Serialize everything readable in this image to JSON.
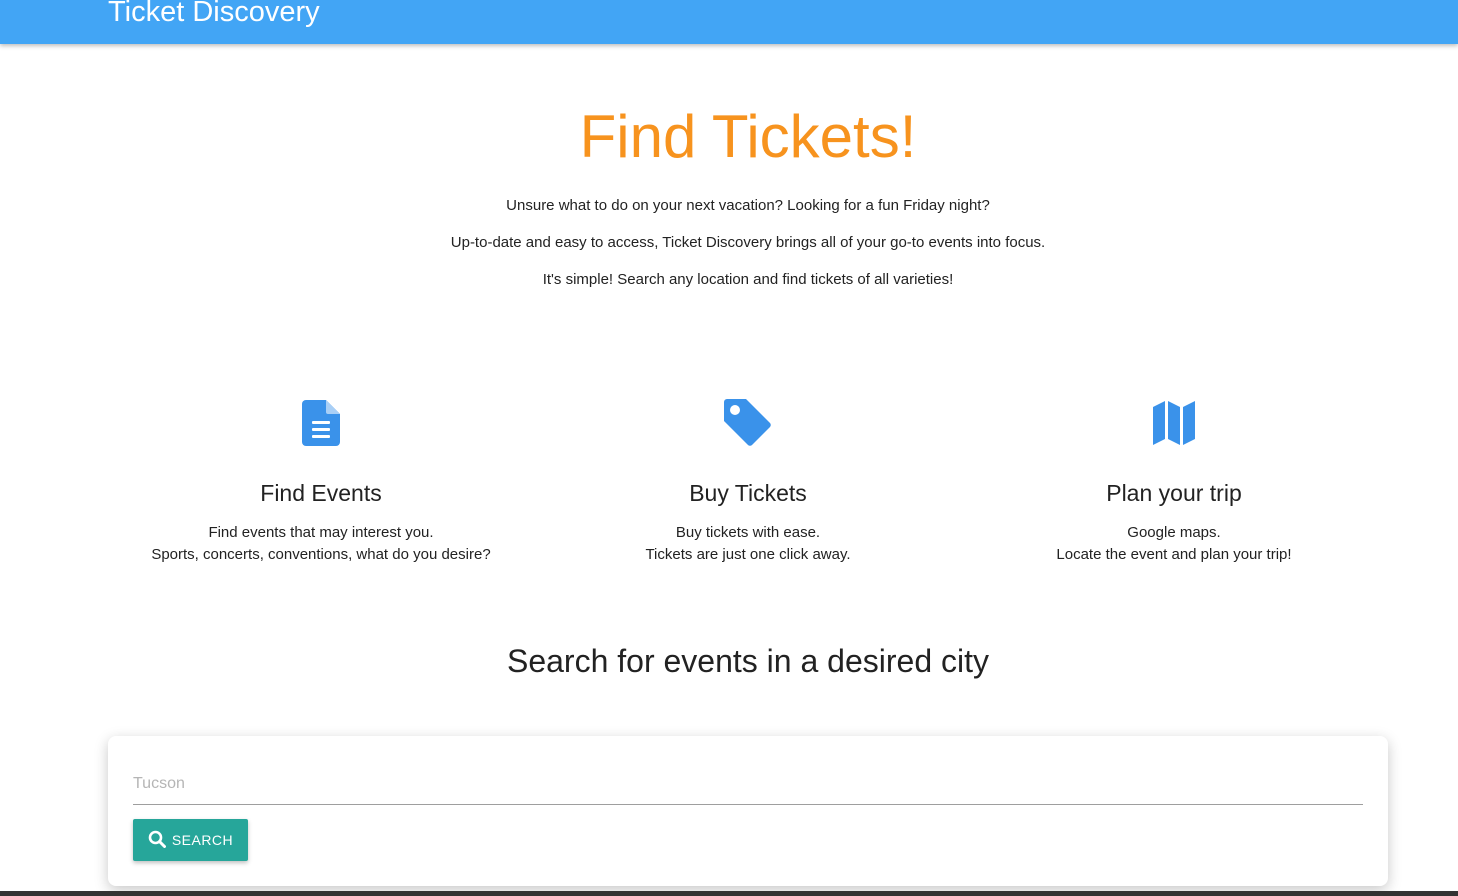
{
  "navbar": {
    "brand": "Ticket Discovery",
    "color": "#42a5f5"
  },
  "hero": {
    "title": "Find Tickets!",
    "title_color": "#f7931e",
    "lines": [
      "Unsure what to do on your next vacation? Looking for a fun Friday night?",
      "Up-to-date and easy to access, Ticket Discovery brings all of your go-to events into focus.",
      "It's simple! Search any location and find tickets of all varieties!"
    ]
  },
  "features": [
    {
      "icon": "file-document-icon",
      "title": "Find Events",
      "line1": "Find events that may interest you.",
      "line2": "Sports, concerts, conventions, what do you desire?"
    },
    {
      "icon": "price-tag-icon",
      "title": "Buy Tickets",
      "line1": "Buy tickets with ease.",
      "line2": "Tickets are just one click away."
    },
    {
      "icon": "map-icon",
      "title": "Plan your trip",
      "line1": "Google maps.",
      "line2": "Locate the event and plan your trip!"
    }
  ],
  "search": {
    "heading": "Search for events in a desired city",
    "placeholder": "Tucson",
    "value": "",
    "button_label": "SEARCH",
    "button_icon": "search-icon",
    "button_color": "#26a69a"
  }
}
